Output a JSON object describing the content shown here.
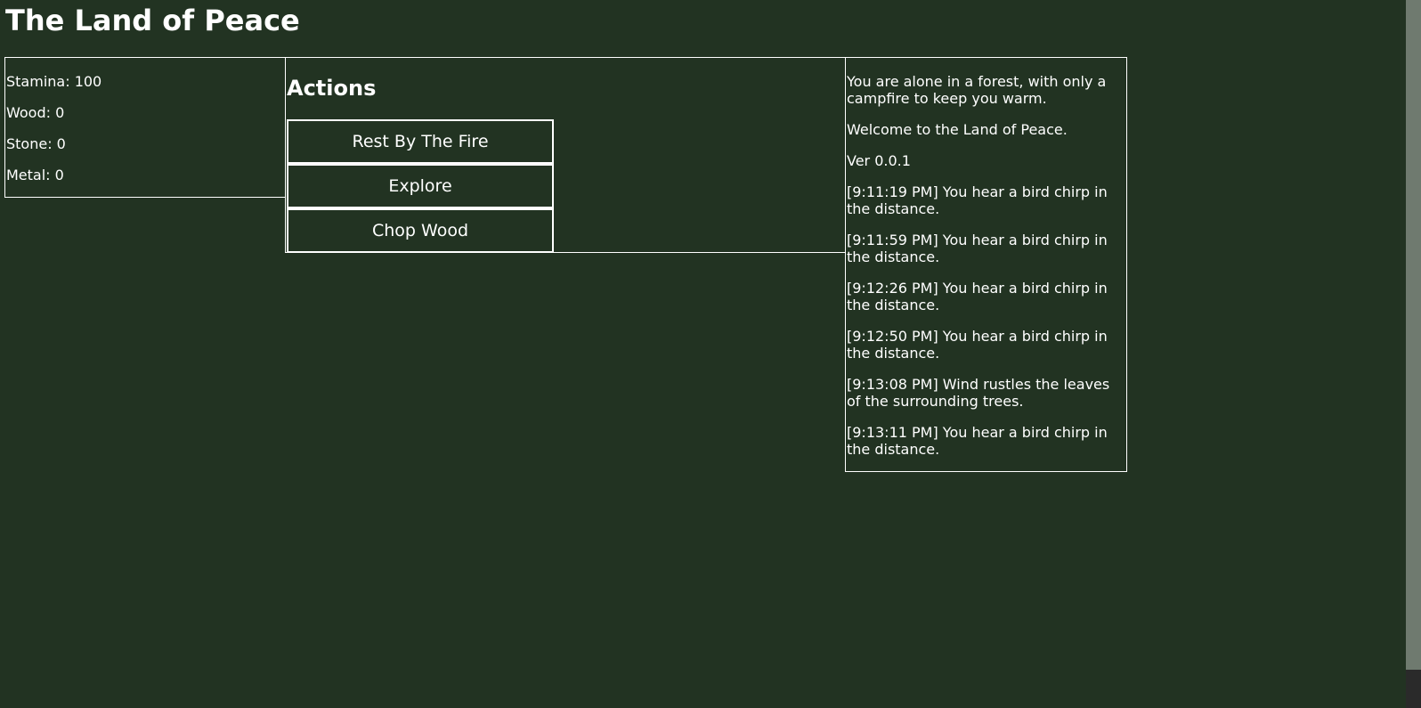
{
  "title": "The Land of Peace",
  "stats": [
    {
      "label": "Stamina: 100"
    },
    {
      "label": "Wood: 0"
    },
    {
      "label": "Stone: 0"
    },
    {
      "label": "Metal: 0"
    }
  ],
  "actions": {
    "heading": "Actions",
    "buttons": [
      {
        "label": "Rest By The Fire"
      },
      {
        "label": "Explore"
      },
      {
        "label": "Chop Wood"
      }
    ]
  },
  "log": [
    "You are alone in a forest, with only a campfire to keep you warm.",
    "Welcome to the Land of Peace.",
    "Ver 0.0.1",
    "[9:11:19 PM] You hear a bird chirp in the distance.",
    "[9:11:59 PM] You hear a bird chirp in the distance.",
    "[9:12:26 PM] You hear a bird chirp in the distance.",
    "[9:12:50 PM] You hear a bird chirp in the distance.",
    "[9:13:08 PM] Wind rustles the leaves of the surrounding trees.",
    "[9:13:11 PM] You hear a bird chirp in the distance."
  ],
  "colors": {
    "background": "#223322",
    "text": "#ffffff",
    "border": "#ffffff"
  }
}
